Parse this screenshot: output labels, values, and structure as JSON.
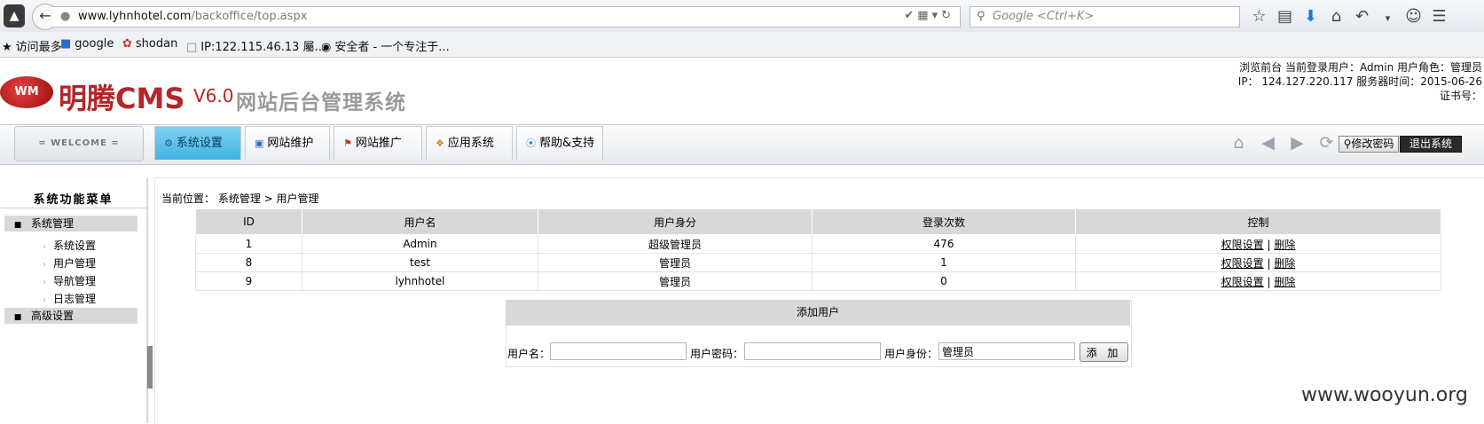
{
  "browser": {
    "url_domain": "www.lyhnhotel.com",
    "url_path": "/backoffice/top.aspx",
    "search_placeholder": "Google <Ctrl+K>",
    "bookmarks": [
      "访问最多",
      "google",
      "shodan",
      "IP:122.115.46.13 屬...",
      "安全者 - 一个专注于..."
    ]
  },
  "header": {
    "logo_badge": "WM",
    "logo_brand": "明腾CMS",
    "logo_version": "V6.0",
    "logo_subtitle": "网站后台管理系统",
    "info_line1": "浏览前台 当前登录用户：Admin 用户角色：管理员",
    "info_line2": "IP： 124.127.220.117 服务器时间：2015-06-26",
    "info_line3": "证书号："
  },
  "nav": {
    "welcome": "= WELCOME =",
    "tabs": [
      "系统设置",
      "网站维护",
      "网站推广",
      "应用系统",
      "帮助&支持"
    ],
    "change_password": "修改密码",
    "logout": "退出系统"
  },
  "sidebar": {
    "title": "系统功能菜单",
    "group1": "系统管理",
    "items": [
      "系统设置",
      "用户管理",
      "导航管理",
      "日志管理"
    ],
    "group2": "高级设置"
  },
  "main": {
    "breadcrumb": "当前位置： 系统管理 > 用户管理",
    "table": {
      "headers": [
        "ID",
        "用户名",
        "用户身分",
        "登录次数",
        "控制"
      ],
      "rows": [
        {
          "id": "1",
          "name": "Admin",
          "role": "超级管理员",
          "logins": "476"
        },
        {
          "id": "8",
          "name": "test",
          "role": "管理员",
          "logins": "1"
        },
        {
          "id": "9",
          "name": "lyhnhotel",
          "role": "管理员",
          "logins": "0"
        }
      ],
      "action_perm": "权限设置",
      "action_sep": "|",
      "action_delete": "删除"
    },
    "add_user": {
      "title": "添加用户",
      "username_label": "用户名：",
      "password_label": "用户密码：",
      "role_label": "用户身份：",
      "role_value": "管理员",
      "submit": "添 加"
    }
  },
  "watermark": "www.wooyun.org"
}
